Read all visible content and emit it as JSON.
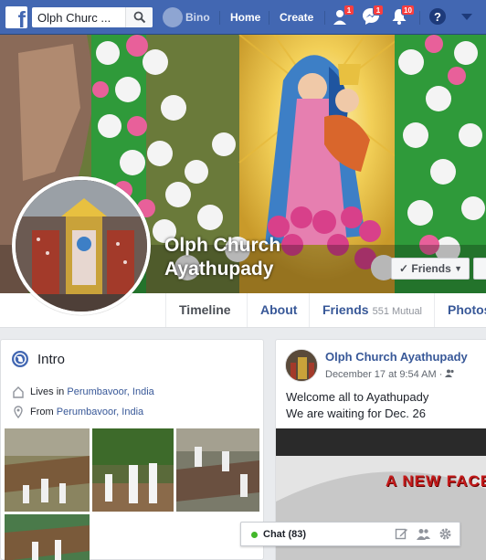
{
  "topbar": {
    "search_value": "Olph Churc ...",
    "profile_name": "Bino",
    "nav": [
      "Home",
      "Create"
    ],
    "friend_requests_count": "1",
    "messages_count": "1",
    "notifications_count": "10"
  },
  "profile": {
    "name": "Olph Church Ayathupady",
    "friends_button": "Friends"
  },
  "tabs": [
    {
      "label": "Timeline"
    },
    {
      "label": "About"
    },
    {
      "label": "Friends",
      "sub": "551 Mutual"
    },
    {
      "label": "Photos"
    }
  ],
  "intro": {
    "title": "Intro",
    "lives_prefix": "Lives in ",
    "lives_place": "Perumbavoor, India",
    "from_prefix": "From ",
    "from_place": "Perumbavoor, India"
  },
  "post": {
    "author": "Olph Church Ayathupady",
    "time": "December 17 at 9:54 AM · ",
    "line1": "Welcome all to Ayathupady",
    "line2": "We are waiting for Dec. 26",
    "media_text": "A NEW FACE"
  },
  "chat": {
    "label": "Chat (83)"
  },
  "colors": {
    "brand_blue": "#4267b2",
    "link_blue": "#385898",
    "online_green": "#42b72a",
    "badge_red": "#fa3e3e"
  },
  "icons": [
    "facebook-logo-icon",
    "search-icon",
    "friend-requests-icon",
    "messenger-icon",
    "notifications-icon",
    "help-icon",
    "dropdown-icon",
    "globe-icon",
    "home-icon",
    "location-pin-icon",
    "friends-icon",
    "compose-icon",
    "gear-icon"
  ]
}
